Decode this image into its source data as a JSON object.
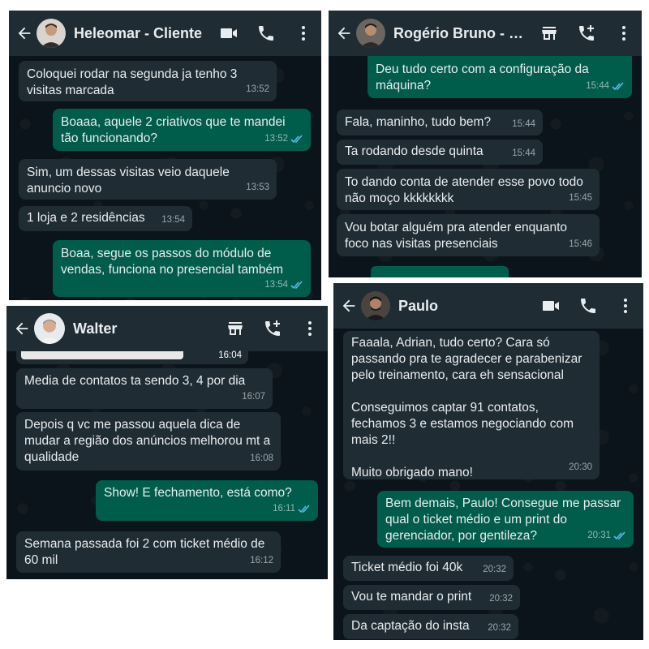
{
  "colors": {
    "chat_bg": "#0b141a",
    "header_bg": "#1f2c34",
    "incoming_bubble": "#1f2c34",
    "outgoing_bubble": "#005c4b",
    "read_ticks": "#53bdeb"
  },
  "panels": [
    {
      "contact_name": "Heleomar - Cliente",
      "header_icons": [
        "video-call-icon",
        "phone-icon",
        "menu-dots-icon"
      ],
      "messages": [
        {
          "dir": "in",
          "text": "Coloquei rodar na segunda ja tenho 3 visitas marcada",
          "time": "13:52"
        },
        {
          "dir": "out",
          "text": "Boaaa, aquele 2 criativos que te mandei tão funcionando?",
          "time": "13:52"
        },
        {
          "dir": "in",
          "text": "Sim, um dessas visitas veio daquele anuncio novo",
          "time": "13:53"
        },
        {
          "dir": "in",
          "text": "1 loja e 2 residências",
          "time": "13:54"
        },
        {
          "dir": "out",
          "text": "Boaa, segue os passos do módulo de vendas, funciona no presencial também",
          "time": "13:54"
        }
      ]
    },
    {
      "contact_name": "Rogério Bruno - Cliente",
      "header_icons": [
        "store-icon",
        "add-call-icon",
        "menu-dots-icon"
      ],
      "messages": [
        {
          "dir": "out",
          "text": "Deu tudo certo com a configuração da máquina?",
          "time": "15:44"
        },
        {
          "dir": "in",
          "text": "Fala, maninho, tudo bem?",
          "time": "15:44"
        },
        {
          "dir": "in",
          "text": "Ta rodando desde quinta",
          "time": "15:44"
        },
        {
          "dir": "in",
          "text": "To dando conta de atender esse povo todo não moço kkkkkkkk",
          "time": "15:45"
        },
        {
          "dir": "in",
          "text": "Vou botar alguém pra atender enquanto foco nas visitas presenciais",
          "time": "15:46"
        }
      ]
    },
    {
      "contact_name": "Walter",
      "header_icons": [
        "store-icon",
        "add-call-icon",
        "menu-dots-icon"
      ],
      "messages": [
        {
          "dir": "in",
          "text": "",
          "time": "16:04"
        },
        {
          "dir": "in",
          "text": "Media de contatos ta sendo 3, 4 por dia",
          "time": "16:07"
        },
        {
          "dir": "in",
          "text": "Depois q vc me passou aquela dica de mudar a região dos anúncios melhorou mt a qualidade",
          "time": "16:08"
        },
        {
          "dir": "out",
          "text": "Show! E fechamento, está como?",
          "time": "16:11"
        },
        {
          "dir": "in",
          "text": "Semana passada foi 2 com ticket médio de 60 mil",
          "time": "16:12"
        }
      ]
    },
    {
      "contact_name": "Paulo",
      "header_icons": [
        "video-call-icon",
        "phone-icon",
        "menu-dots-icon"
      ],
      "messages": [
        {
          "dir": "in",
          "text": "Faaala, Adrian, tudo certo? Cara só passando pra te agradecer e parabenizar pelo treinamento, cara eh sensacional\n\nConseguimos captar 91 contatos, fechamos 3 e estamos negociando com mais 2!!\n\nMuito obrigado mano!",
          "time": "20:30"
        },
        {
          "dir": "out",
          "text": "Bem demais, Paulo! Consegue me passar qual o ticket médio e um print do gerenciador, por gentileza?",
          "time": "20:31"
        },
        {
          "dir": "in",
          "text": "Ticket médio foi 40k",
          "time": "20:32"
        },
        {
          "dir": "in",
          "text": "Vou te mandar o print",
          "time": "20:32"
        },
        {
          "dir": "in",
          "text": "Da captação do insta",
          "time": "20:32"
        }
      ]
    }
  ]
}
